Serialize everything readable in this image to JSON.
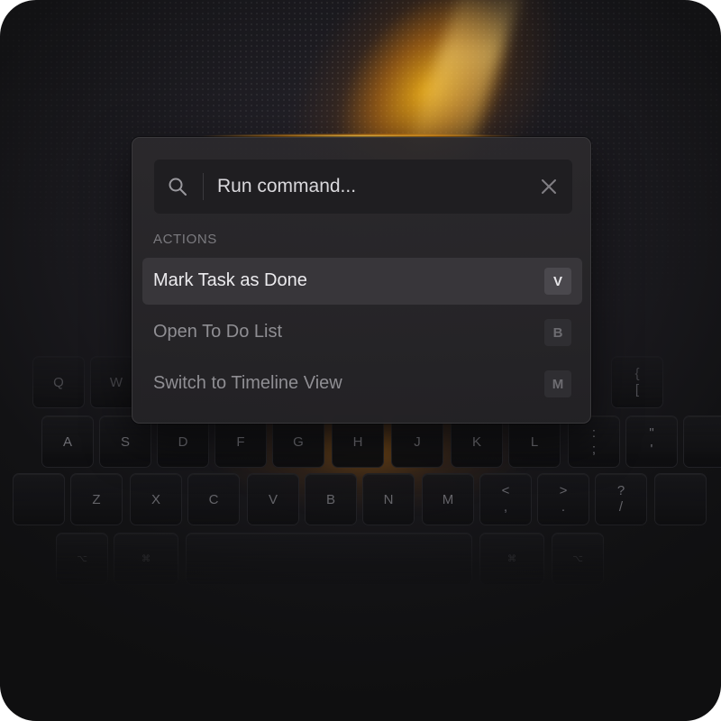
{
  "palette": {
    "search": {
      "placeholder": "Run command..."
    },
    "section_label": "ACTIONS",
    "items": [
      {
        "label": "Mark Task as Done",
        "shortcut": "V",
        "active": true
      },
      {
        "label": "Open To Do List",
        "shortcut": "B",
        "active": false
      },
      {
        "label": "Switch to Timeline View",
        "shortcut": "M",
        "active": false
      }
    ]
  },
  "keyboard": {
    "row_top": [
      "Q",
      "W",
      "{",
      "["
    ],
    "row_home": [
      "A",
      "S",
      "D",
      "F",
      "G",
      "H",
      "J",
      "K",
      "L",
      ":",
      ";",
      "\"",
      "'"
    ],
    "row_bottom": [
      "Z",
      "X",
      "C",
      "V",
      "B",
      "N",
      "M",
      "<",
      ",",
      ">",
      ".",
      "?",
      "/"
    ],
    "row_mods": [
      "⌥",
      "⌘",
      "⌘",
      "⌥"
    ]
  },
  "colors": {
    "accent_glow": "#ffb414",
    "panel": "#2a292c",
    "active_row": "#38363a"
  },
  "icons": {
    "search": "search-icon",
    "close": "close-icon"
  }
}
